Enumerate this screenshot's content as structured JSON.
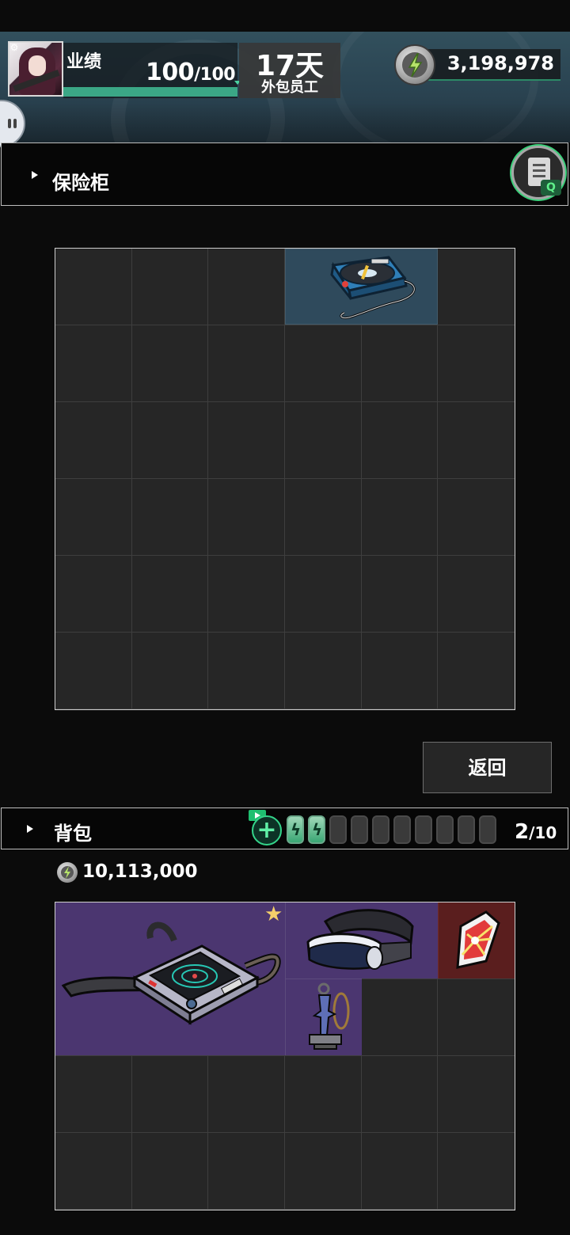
{
  "header": {
    "stat_label": "业绩",
    "stat_current": "100",
    "stat_max": "/100",
    "stat_fill_fraction": 1.0,
    "days_value": "17天",
    "days_label": "外包员工",
    "currency": "3,198,978"
  },
  "safe": {
    "title": "保险柜",
    "rows": 6,
    "cols": 6,
    "items": [
      {
        "name": "blue-cd-player",
        "icon": "cd-player-icon"
      }
    ]
  },
  "back_label": "返回",
  "backpack": {
    "title": "背包",
    "capacity_used": "2",
    "capacity_max": "/10",
    "batteries_full": 2,
    "batteries_total": 10,
    "money": "10,113,000",
    "rows": 4,
    "cols": 6,
    "items": [
      {
        "name": "radar-device",
        "icon": "radar-device-icon",
        "starred": true
      },
      {
        "name": "vr-headset",
        "icon": "vr-headset-icon"
      },
      {
        "name": "keychain-figure",
        "icon": "keychain-icon"
      },
      {
        "name": "red-crystal",
        "icon": "crystal-icon"
      }
    ]
  },
  "colors": {
    "accent_green": "#3ba786",
    "rare_purple": "#4b3670",
    "legend_red": "#5a1e1e",
    "common_blue": "#2f4a5c"
  }
}
